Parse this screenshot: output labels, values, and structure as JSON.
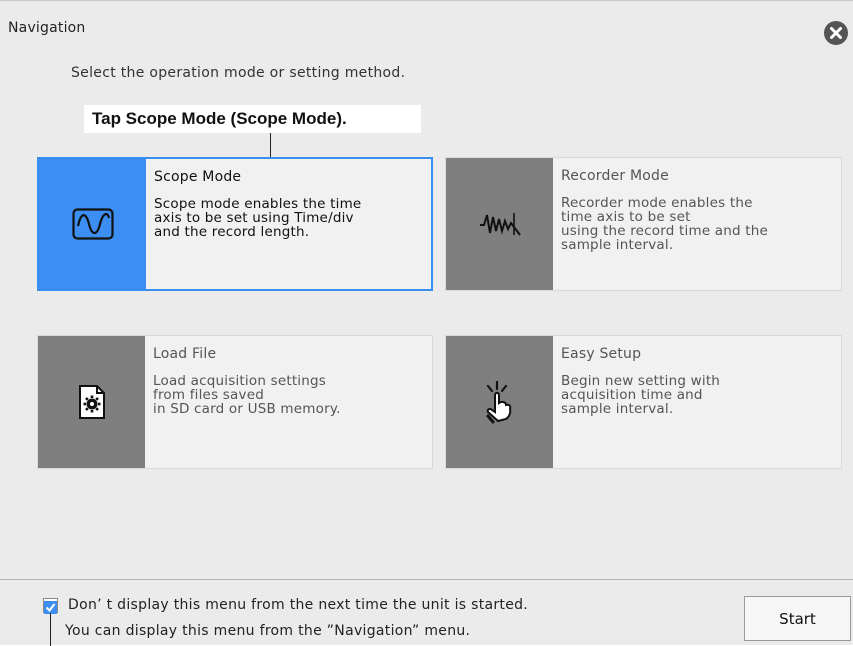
{
  "window": {
    "title": "Navigation",
    "close_icon": "close-icon"
  },
  "instruction": "Select the operation mode or setting method.",
  "callout": "Tap Scope Mode (Scope Mode).",
  "cards": [
    {
      "label": "Scope Mode",
      "desc": "Scope mode enables the time\naxis to be set using Time/div\nand the record length.",
      "icon": "sine-wave-icon",
      "selected": true
    },
    {
      "label": "Recorder Mode",
      "desc": "Recorder mode enables the\ntime axis to be set\nusing the record time and the\nsample interval.",
      "icon": "recorder-wave-icon",
      "selected": false
    },
    {
      "label": "Load File",
      "desc": "Load acquisition settings\nfrom files saved\nin SD card or USB memory.",
      "icon": "file-gear-icon",
      "selected": false
    },
    {
      "label": "Easy Setup",
      "desc": "Begin new setting with\nacquisition time and\nsample interval.",
      "icon": "tap-hand-icon",
      "selected": false
    }
  ],
  "footer": {
    "checkbox_checked": true,
    "line1": "Don’ t display this menu from the next time the unit is started.",
    "line2": "You can display this menu from the  ”Navigation” menu.",
    "start_label": "Start"
  },
  "colors": {
    "accent": "#3d8ef2",
    "icon_bg": "#7f7f7f",
    "card_bg": "#f1f1f1",
    "dialog_bg": "#ebebeb"
  }
}
